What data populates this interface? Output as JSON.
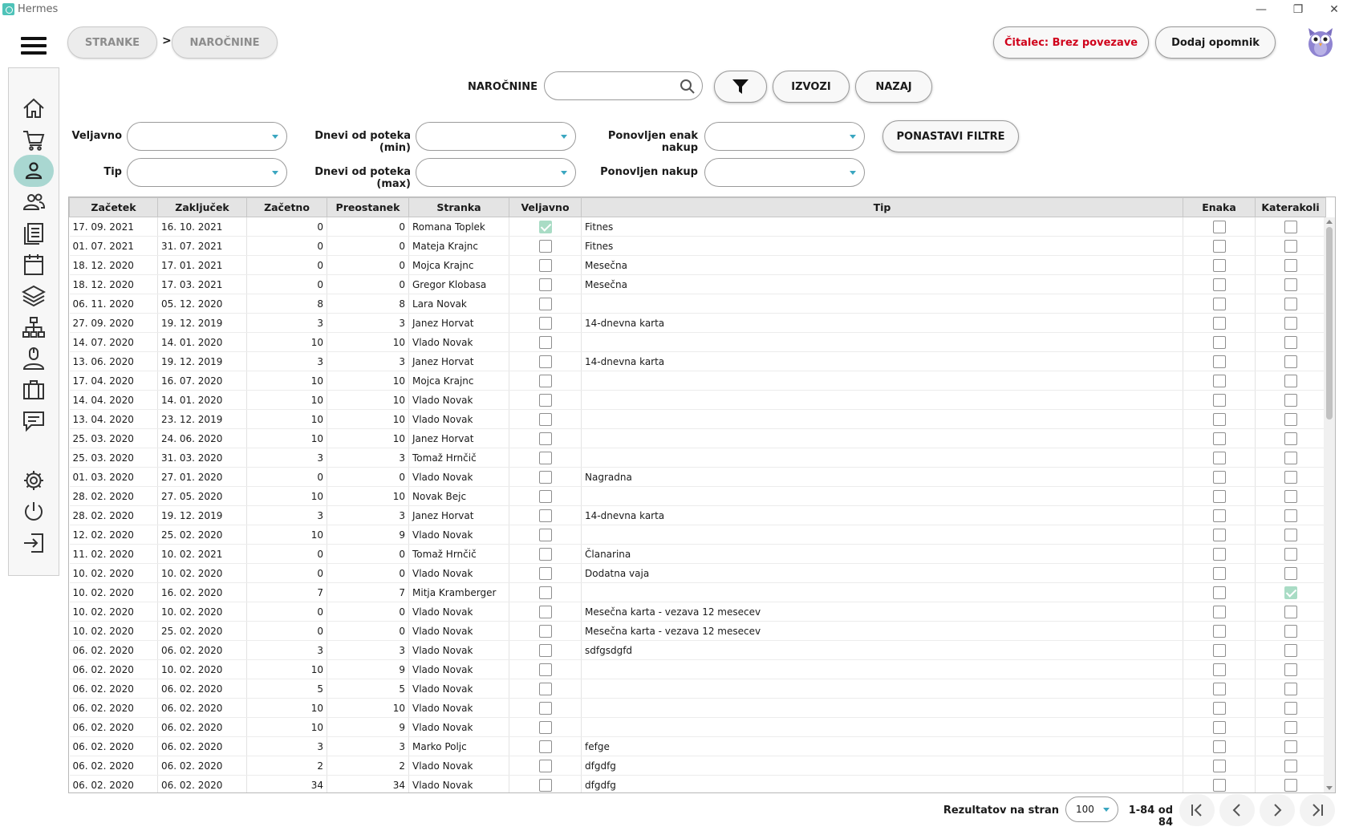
{
  "window": {
    "title": "Hermes"
  },
  "breadcrumb": {
    "items": [
      "STRANKE",
      "NAROČNINE"
    ],
    "separator": ">"
  },
  "header": {
    "reader_status": "Čitalec: Brez povezave",
    "add_reminder": "Dodaj opomnik",
    "reader_status_color": "#d0021b"
  },
  "search": {
    "label": "NAROČNINE",
    "value": "",
    "filter_icon": "filter-icon",
    "export_label": "IZVOZI",
    "back_label": "NAZAJ"
  },
  "filters": {
    "valid_label": "Veljavno",
    "type_label": "Tip",
    "days_min_label": "Dnevi od poteka (min)",
    "days_max_label": "Dnevi od poteka (max)",
    "repeat_same_label": "Ponovljen enak nakup",
    "repeat_label": "Ponovljen nakup",
    "reset_label": "PONASTAVI FILTRE"
  },
  "sidebar": {
    "items": [
      "home-icon",
      "cart-icon",
      "user-icon",
      "users-icon",
      "documents-icon",
      "calendar-icon",
      "layers-icon",
      "network-icon",
      "mouse-user-icon",
      "briefcase-icon",
      "chat-icon",
      "gear-icon",
      "power-icon",
      "logout-icon"
    ],
    "active": "user-icon",
    "accent": "#a9d7d1"
  },
  "table": {
    "columns": [
      "Začetek",
      "Zaključek",
      "Začetno",
      "Preostanek",
      "Stranka",
      "Veljavno",
      "Tip",
      "Enaka",
      "Katerakoli"
    ],
    "rows": [
      [
        "17. 09. 2021",
        "16. 10. 2021",
        "0",
        "0",
        "Romana Toplek",
        true,
        "Fitnes",
        false,
        false
      ],
      [
        "01. 07. 2021",
        "31. 07. 2021",
        "0",
        "0",
        "Mateja Krajnc",
        false,
        "Fitnes",
        false,
        false
      ],
      [
        "18. 12. 2020",
        "17. 01. 2021",
        "0",
        "0",
        "Mojca Krajnc",
        false,
        "Mesečna",
        false,
        false
      ],
      [
        "18. 12. 2020",
        "17. 03. 2021",
        "0",
        "0",
        "Gregor Klobasa",
        false,
        "Mesečna",
        false,
        false
      ],
      [
        "06. 11. 2020",
        "05. 12. 2020",
        "8",
        "8",
        "Lara Novak",
        false,
        "",
        false,
        false
      ],
      [
        "27. 09. 2020",
        "19. 12. 2019",
        "3",
        "3",
        "Janez Horvat",
        false,
        "14-dnevna karta",
        false,
        false
      ],
      [
        "14. 07. 2020",
        "14. 01. 2020",
        "10",
        "10",
        "Vlado Novak",
        false,
        "",
        false,
        false
      ],
      [
        "13. 06. 2020",
        "19. 12. 2019",
        "3",
        "3",
        "Janez Horvat",
        false,
        "14-dnevna karta",
        false,
        false
      ],
      [
        "17. 04. 2020",
        "16. 07. 2020",
        "10",
        "10",
        "Mojca Krajnc",
        false,
        "",
        false,
        false
      ],
      [
        "14. 04. 2020",
        "14. 01. 2020",
        "10",
        "10",
        "Vlado Novak",
        false,
        "",
        false,
        false
      ],
      [
        "13. 04. 2020",
        "23. 12. 2019",
        "10",
        "10",
        "Vlado Novak",
        false,
        "",
        false,
        false
      ],
      [
        "25. 03. 2020",
        "24. 06. 2020",
        "10",
        "10",
        "Janez Horvat",
        false,
        "",
        false,
        false
      ],
      [
        "25. 03. 2020",
        "31. 03. 2020",
        "3",
        "3",
        "Tomaž Hrnčič",
        false,
        "",
        false,
        false
      ],
      [
        "01. 03. 2020",
        "27. 01. 2020",
        "0",
        "0",
        "Vlado Novak",
        false,
        "Nagradna",
        false,
        false
      ],
      [
        "28. 02. 2020",
        "27. 05. 2020",
        "10",
        "10",
        "Novak Bejc",
        false,
        "",
        false,
        false
      ],
      [
        "28. 02. 2020",
        "19. 12. 2019",
        "3",
        "3",
        "Janez Horvat",
        false,
        "14-dnevna karta",
        false,
        false
      ],
      [
        "12. 02. 2020",
        "25. 02. 2020",
        "10",
        "9",
        "Vlado Novak",
        false,
        "",
        false,
        false
      ],
      [
        "11. 02. 2020",
        "10. 02. 2021",
        "0",
        "0",
        "Tomaž Hrnčič",
        false,
        "Članarina",
        false,
        false
      ],
      [
        "10. 02. 2020",
        "10. 02. 2020",
        "0",
        "0",
        "Vlado Novak",
        false,
        "Dodatna vaja",
        false,
        false
      ],
      [
        "10. 02. 2020",
        "16. 02. 2020",
        "7",
        "7",
        "Mitja Kramberger",
        false,
        "",
        false,
        true
      ],
      [
        "10. 02. 2020",
        "10. 02. 2020",
        "0",
        "0",
        "Vlado Novak",
        false,
        "Mesečna karta - vezava 12 mesecev",
        false,
        false
      ],
      [
        "10. 02. 2020",
        "25. 02. 2020",
        "0",
        "0",
        "Vlado Novak",
        false,
        "Mesečna karta - vezava 12 mesecev",
        false,
        false
      ],
      [
        "06. 02. 2020",
        "06. 02. 2020",
        "3",
        "3",
        "Vlado Novak",
        false,
        "sdfgsdgfd",
        false,
        false
      ],
      [
        "06. 02. 2020",
        "10. 02. 2020",
        "10",
        "9",
        "Vlado Novak",
        false,
        "",
        false,
        false
      ],
      [
        "06. 02. 2020",
        "06. 02. 2020",
        "5",
        "5",
        "Vlado Novak",
        false,
        "",
        false,
        false
      ],
      [
        "06. 02. 2020",
        "06. 02. 2020",
        "10",
        "10",
        "Vlado Novak",
        false,
        "",
        false,
        false
      ],
      [
        "06. 02. 2020",
        "06. 02. 2020",
        "10",
        "9",
        "Vlado Novak",
        false,
        "",
        false,
        false
      ],
      [
        "06. 02. 2020",
        "06. 02. 2020",
        "3",
        "3",
        "Marko Poljc",
        false,
        "fefge",
        false,
        false
      ],
      [
        "06. 02. 2020",
        "06. 02. 2020",
        "2",
        "2",
        "Vlado Novak",
        false,
        "dfgdfg",
        false,
        false
      ],
      [
        "06. 02. 2020",
        "06. 02. 2020",
        "34",
        "34",
        "Vlado Novak",
        false,
        "dfgdfg",
        false,
        false
      ]
    ],
    "check_color": "#a9dcc5"
  },
  "pagination": {
    "label": "Rezultatov na stran",
    "page_size": "100",
    "range": "1-84 od 84"
  }
}
